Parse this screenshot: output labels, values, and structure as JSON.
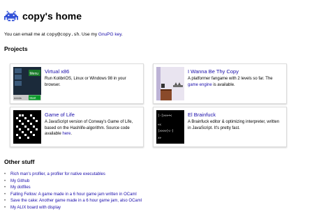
{
  "header": {
    "title": "copy's home",
    "logo_icon": "space-invader-icon",
    "logo_color": "#2a4ad6"
  },
  "intro": {
    "before": "You can email me at ",
    "email": "copy@copy.sh",
    "middle": ". Use my ",
    "link": "GnuPG key",
    "after": "."
  },
  "projects": {
    "heading": "Projects",
    "items": [
      {
        "title": "Virtual x86",
        "desc": "Run KolibriOS, Linux or Windows 98 in your browser.",
        "link": "",
        "after": ""
      },
      {
        "title": "I Wanna Be Thy Copy",
        "desc": "A platformer fangame with 2 levels so far. The ",
        "link": "game engine",
        "after": " is available."
      },
      {
        "title": "Game of Life",
        "desc": "A JavaScript version of Conway's Game of Life, based on the Hashlife-algorithm. Source code available ",
        "link": "here",
        "after": "."
      },
      {
        "title": "El Brainfuck",
        "desc": "A Brainfuck editor & optimizing interpreter, written in JavaScript. It's pretty fast.",
        "link": "",
        "after": ""
      }
    ],
    "thumb_text": {
      "x86_menu": "Menu",
      "x86_start": "Start",
      "x86_bottom": "eeeds",
      "bf_line1": "[-[>>>+<",
      "bf_line2": "<<",
      "bf_line3": "[>>>>[<-]",
      "bf_line4": ">>"
    }
  },
  "other": {
    "heading": "Other stuff",
    "items": [
      "Rich man's profiler, a profiler for native executables",
      "My Github",
      "My dotfiles",
      "Falling Fellow: A game made in a 6 hour game jam written in OCaml",
      "Save the cake: Another game made in a 6 hour game jam, also OCaml",
      "My ALIX board with display"
    ]
  }
}
